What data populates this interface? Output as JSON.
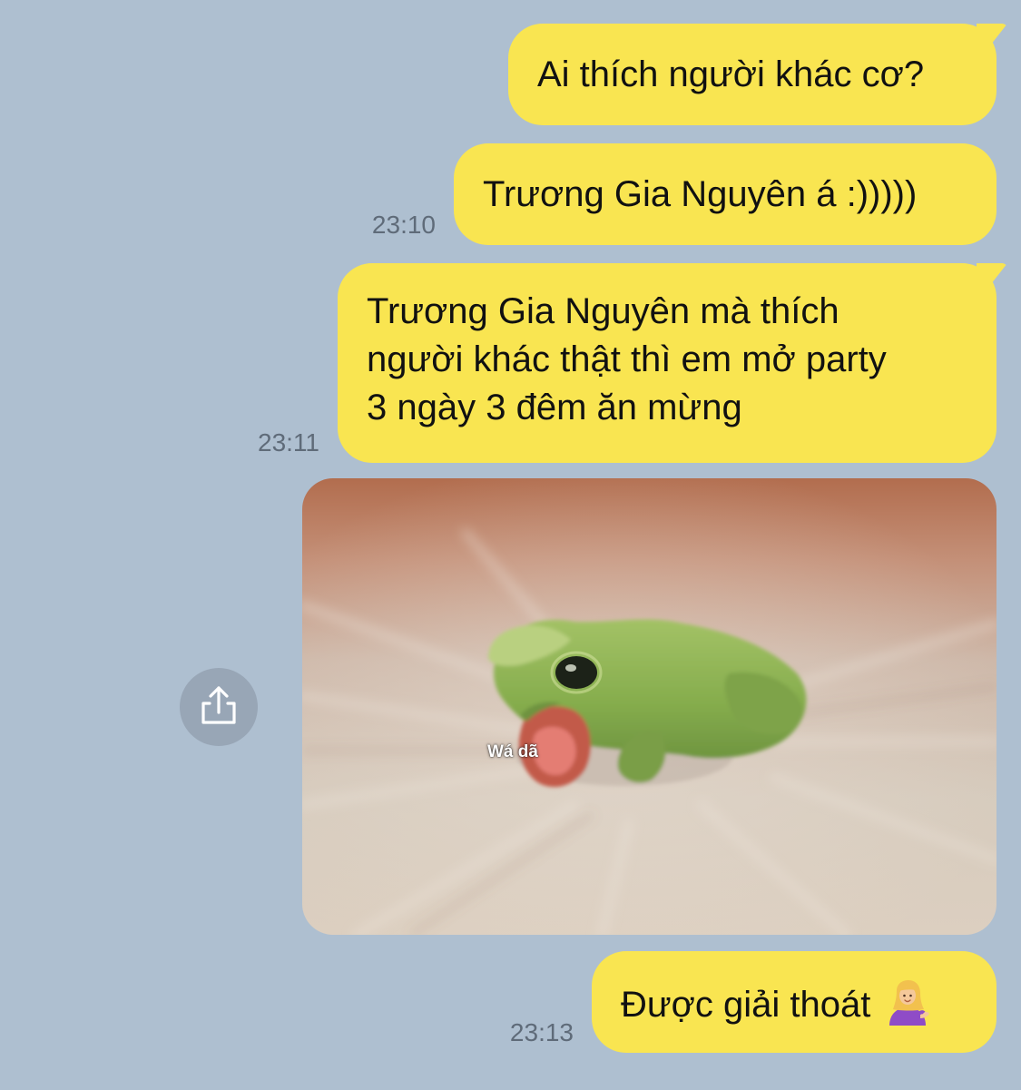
{
  "conversation": {
    "messages": [
      {
        "sender": "me",
        "text": "Ai thích người khác cơ?"
      },
      {
        "sender": "me",
        "text": "Trương Gia Nguyên á :)))))",
        "time": "23:10"
      },
      {
        "sender": "me",
        "text": "Trương Gia Nguyên mà thích\nngười khác thật thì em mở party\n3 ngày 3 đêm ăn mừng",
        "time": "23:11"
      },
      {
        "sender": "me",
        "type": "image",
        "caption": "Wá dã",
        "depicts": "frog-meme"
      },
      {
        "sender": "me",
        "text": "Được giải thoát",
        "emoji": "person-tipping-hand-emoji",
        "time": "23:13"
      }
    ]
  },
  "actions": {
    "share_icon": "share-icon"
  },
  "colors": {
    "background": "#aebfd0",
    "bubble": "#f9e551",
    "timestamp": "#5f6b79",
    "share_button": "#98a6b6"
  }
}
